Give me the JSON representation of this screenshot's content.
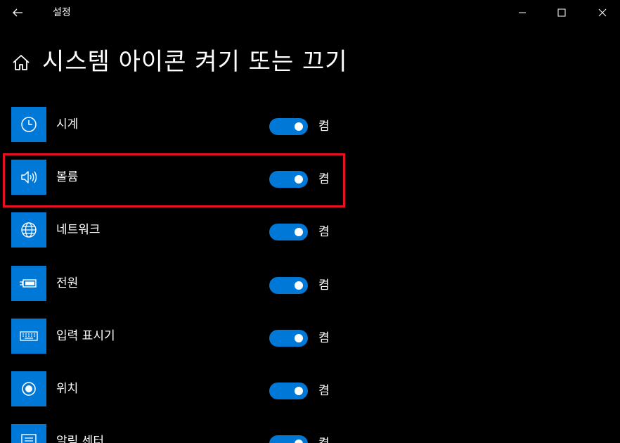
{
  "window": {
    "app_title": "설정",
    "back_icon": "back-arrow-icon",
    "minimize_icon": "minimize-icon",
    "maximize_icon": "maximize-icon",
    "close_icon": "close-icon"
  },
  "header": {
    "home_icon": "home-icon",
    "title": "시스템 아이콘 켜기 또는 끄기"
  },
  "colors": {
    "background": "#000000",
    "accent": "#0078d7",
    "highlight": "#e81123",
    "text": "#ffffff"
  },
  "items": [
    {
      "label": "시계",
      "icon": "clock-icon",
      "state": "켬",
      "on": true
    },
    {
      "label": "볼륨",
      "icon": "speaker-icon",
      "state": "켬",
      "on": true,
      "highlighted": true
    },
    {
      "label": "네트워크",
      "icon": "globe-icon",
      "state": "켬",
      "on": true
    },
    {
      "label": "전원",
      "icon": "battery-icon",
      "state": "켬",
      "on": true
    },
    {
      "label": "입력 표시기",
      "icon": "keyboard-icon",
      "state": "켬",
      "on": true
    },
    {
      "label": "위치",
      "icon": "location-icon",
      "state": "켬",
      "on": true
    },
    {
      "label": "알림 센터",
      "icon": "notification-icon",
      "state": "켬",
      "on": true
    }
  ]
}
